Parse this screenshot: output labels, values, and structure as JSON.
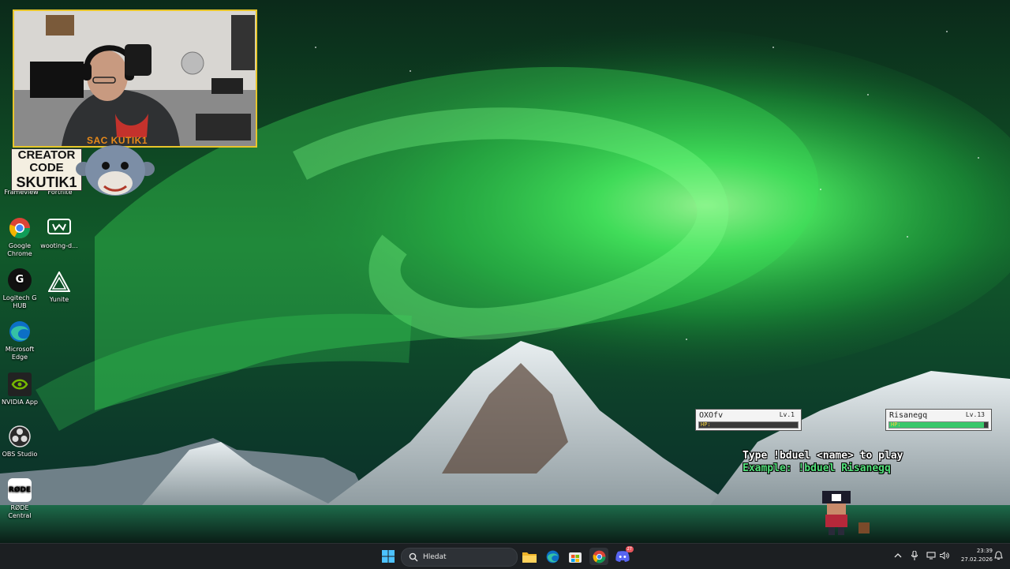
{
  "webcam": {
    "brand_text": "SAC KUTIK1"
  },
  "creator_code": {
    "line1": "CREATOR",
    "line2": "CODE",
    "line3": "SKUTIK1"
  },
  "desktop": {
    "icons": [
      {
        "label": "Google Chrome",
        "icon": "chrome-icon"
      },
      {
        "label": "wooting-d...",
        "icon": "wooting-icon"
      },
      {
        "label": "Logitech G HUB",
        "icon": "logitech-ghub-icon"
      },
      {
        "label": "Yunite",
        "icon": "yunite-icon"
      },
      {
        "label": "Microsoft Edge",
        "icon": "edge-icon"
      },
      {
        "label": "NVIDIA App",
        "icon": "nvidia-icon"
      },
      {
        "label": "OBS Studio",
        "icon": "obs-icon"
      },
      {
        "label": "RØDE Central",
        "icon": "rode-icon"
      }
    ],
    "partial_labels": [
      "Frameview",
      "Fortnite"
    ]
  },
  "duel": {
    "player1": {
      "name": "OXOfv",
      "level": "Lv.1",
      "hp_label": "HP:",
      "hp_fraction": 0.0
    },
    "player2": {
      "name": "Risanegq",
      "level": "Lv.13",
      "hp_label": "HP:",
      "hp_fraction": 0.96
    },
    "instruction": "Type !bduel <name> to play",
    "example": "Example: !bduel Risanegq"
  },
  "taskbar": {
    "search_placeholder": "Hledat",
    "apps": [
      "start-icon",
      "file-explorer-icon",
      "edge-icon",
      "store-icon",
      "chrome-icon",
      "discord-icon"
    ],
    "discord_badge": "27",
    "clock_time": "23:39",
    "clock_date": "27.02.2026"
  },
  "colors": {
    "webcam_border": "#e8c52b",
    "aurora": "#3fe85a",
    "hp_fill": "#39c76b",
    "example_text": "#52e07a",
    "taskbar_bg": "#1c1f22"
  }
}
